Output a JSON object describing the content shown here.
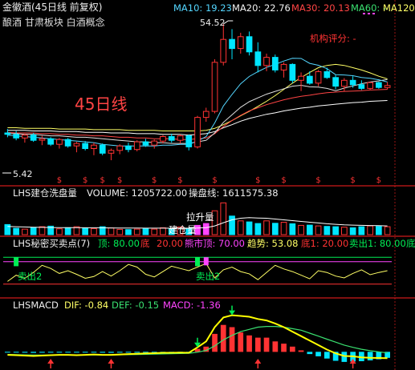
{
  "colors": {
    "bg": "#000000",
    "up": "#ff3333",
    "down": "#00e5ff",
    "ma10": "#54d6ff",
    "ma20": "#f2f2f2",
    "ma30": "#ff4444",
    "ma60": "#3ae070",
    "ma120": "#ffff66",
    "grid": "#ff2020",
    "magenta": "#ff44ff",
    "white": "#ffffff",
    "yellow": "#ffff00",
    "green": "#00ee55",
    "label": "#dddddd"
  },
  "price_panel": {
    "title": "金徽酒(45日线 前复权)",
    "concepts": "酿酒 甘肃板块 白酒概念",
    "ma10_label": "MA10: 19.23",
    "ma20_label": "MA20: 22.76",
    "ma30_label": "MA30: 20.13",
    "ma60_label": "MA60: -",
    "ma120_label": "MA120",
    "rating_label": "机构评分: -",
    "period_annotation": "45日线",
    "high_marker": "54.52",
    "low_marker": "5.42",
    "signal_glyph": "$"
  },
  "volume_panel": {
    "name": "LHS建仓洗盘量",
    "volume_label": "VOLUME: 1205722.00",
    "control_label": "操盘线: 1611575.38",
    "tag_top": "拉升量",
    "tag_bottom": "建仓量"
  },
  "signal_panel": {
    "name": "LHS秘密买卖点(7)",
    "top_label": "顶: 80.00",
    "bottom_label": "底",
    "bottom_value": "20.00",
    "bull_top_label": "熊市顶: 70.00",
    "trend_label": "趋势: 53.08",
    "bottom1_label": "底1: 20.00",
    "sell1_label": "卖出1: 80.00",
    "tail_label": "底",
    "sell2_tag": "卖出2"
  },
  "macd_panel": {
    "name": "LHSMACD",
    "dif_label": "DIF: -0.84",
    "def_label": "DEF: -0.15",
    "macd_label": "MACD: -1.36"
  },
  "chart_data": [
    {
      "type": "candlestick",
      "title": "金徽酒(45日线 前复权)",
      "ohlc": [
        [
          8.6,
          9.2,
          8.0,
          8.4
        ],
        [
          8.4,
          8.9,
          7.6,
          7.9
        ],
        [
          7.9,
          8.5,
          7.3,
          8.3
        ],
        [
          8.3,
          8.6,
          7.4,
          7.6
        ],
        [
          7.6,
          8.2,
          7.0,
          7.8
        ],
        [
          7.8,
          8.0,
          6.9,
          7.1
        ],
        [
          7.1,
          7.9,
          6.6,
          7.7
        ],
        [
          7.7,
          7.9,
          6.7,
          6.9
        ],
        [
          6.9,
          7.4,
          6.2,
          7.2
        ],
        [
          7.2,
          7.5,
          6.4,
          6.6
        ],
        [
          6.6,
          7.3,
          5.9,
          7.0
        ],
        [
          7.0,
          7.2,
          5.9,
          6.1
        ],
        [
          6.1,
          6.6,
          5.42,
          6.4
        ],
        [
          6.4,
          7.1,
          6.0,
          6.9
        ],
        [
          6.9,
          7.3,
          6.2,
          6.5
        ],
        [
          6.5,
          7.6,
          6.3,
          7.4
        ],
        [
          7.4,
          7.8,
          6.8,
          7.0
        ],
        [
          7.0,
          7.7,
          6.6,
          7.5
        ],
        [
          7.5,
          8.3,
          7.2,
          8.1
        ],
        [
          8.1,
          8.5,
          7.3,
          7.6
        ],
        [
          7.6,
          8.4,
          7.2,
          8.2
        ],
        [
          8.2,
          8.4,
          6.4,
          6.8
        ],
        [
          6.8,
          11.5,
          6.6,
          11.2
        ],
        [
          11.2,
          13.2,
          10.4,
          12.4
        ],
        [
          12.4,
          30.0,
          12.0,
          28.5
        ],
        [
          28.5,
          54.52,
          27.0,
          42.0
        ],
        [
          42.0,
          50.0,
          30.0,
          36.0
        ],
        [
          36.0,
          47.0,
          33.0,
          44.0
        ],
        [
          44.0,
          48.0,
          32.0,
          34.0
        ],
        [
          34.0,
          40.0,
          24.0,
          27.0
        ],
        [
          27.0,
          33.0,
          24.5,
          31.0
        ],
        [
          31.0,
          32.5,
          24.0,
          25.0
        ],
        [
          25.0,
          28.5,
          22.0,
          27.5
        ],
        [
          27.5,
          28.0,
          20.0,
          21.0
        ],
        [
          21.0,
          24.0,
          17.5,
          22.5
        ],
        [
          22.5,
          24.5,
          19.5,
          20.0
        ],
        [
          20.0,
          25.0,
          19.0,
          24.3
        ],
        [
          24.3,
          26.0,
          21.5,
          22.0
        ],
        [
          22.0,
          23.0,
          18.0,
          19.0
        ],
        [
          19.0,
          21.8,
          17.5,
          21.0
        ],
        [
          21.0,
          22.5,
          18.5,
          19.5
        ],
        [
          19.5,
          21.0,
          17.8,
          18.3
        ],
        [
          18.3,
          20.5,
          17.8,
          20.2
        ],
        [
          20.2,
          20.5,
          18.2,
          18.6
        ],
        [
          18.6,
          20.4,
          18.0,
          19.23
        ]
      ],
      "ma10": [
        8.3,
        8.2,
        8.1,
        8.0,
        7.9,
        7.8,
        7.7,
        7.6,
        7.5,
        7.4,
        7.3,
        7.1,
        7.0,
        6.9,
        6.9,
        6.9,
        6.9,
        6.9,
        7.0,
        7.0,
        7.1,
        7.1,
        7.5,
        8.1,
        10.2,
        13.6,
        16.5,
        19.8,
        22.4,
        24.3,
        26.1,
        27.5,
        29.1,
        30.5,
        30.4,
        28.0,
        27.1,
        25.6,
        23.1,
        23.0,
        22.7,
        22.0,
        21.7,
        21.2,
        20.4
      ],
      "ma20": [
        8.5,
        8.5,
        8.4,
        8.4,
        8.3,
        8.2,
        8.2,
        8.1,
        8.0,
        8.0,
        7.9,
        7.8,
        7.7,
        7.6,
        7.5,
        7.4,
        7.4,
        7.3,
        7.3,
        7.2,
        7.2,
        7.2,
        7.4,
        7.6,
        8.6,
        10.3,
        11.7,
        13.3,
        14.6,
        15.6,
        16.6,
        17.4,
        18.2,
        19.0,
        19.3,
        18.8,
        18.7,
        18.3,
        17.6,
        18.4,
        19.1,
        19.8,
        20.4,
        20.8,
        21.3
      ],
      "ma30": [
        8.7,
        8.6,
        8.6,
        8.6,
        8.5,
        8.5,
        8.4,
        8.4,
        8.3,
        8.3,
        8.2,
        8.2,
        8.1,
        8.0,
        8.0,
        7.9,
        7.9,
        7.8,
        7.8,
        7.8,
        7.7,
        7.7,
        7.8,
        7.9,
        8.5,
        9.6,
        10.6,
        11.6,
        12.5,
        13.2,
        13.9,
        14.5,
        15.1,
        15.6,
        16.0,
        16.3,
        16.7,
        17.0,
        17.2,
        17.4,
        17.5,
        17.6,
        17.8,
        17.9,
        18.0
      ],
      "ma60": [
        9.0,
        9.0,
        9.0,
        8.9,
        8.9,
        8.9,
        8.8,
        8.8,
        8.8,
        8.7,
        8.7,
        8.7,
        8.6,
        8.6,
        8.6,
        8.5,
        8.5,
        8.5,
        8.4,
        8.4,
        8.4,
        8.3,
        8.4,
        8.5,
        8.8,
        9.4,
        9.9,
        10.5,
        11.0,
        11.4,
        11.8,
        12.1,
        12.5,
        12.8,
        13.1,
        13.3,
        13.6,
        13.8,
        14.0,
        14.2,
        14.4,
        14.5,
        14.7,
        14.8,
        14.9
      ],
      "ma120": [
        9.4,
        9.4,
        9.3,
        9.3,
        9.3,
        9.3,
        9.2,
        9.2,
        9.2,
        9.2,
        9.1,
        9.1,
        9.1,
        9.1,
        9.0,
        9.0,
        9.0,
        9.0,
        8.9,
        8.9,
        8.9,
        8.9,
        8.9,
        9.0,
        9.3,
        9.9,
        10.6,
        11.5,
        12.4,
        13.5,
        14.7,
        16.2,
        18.0,
        20.0,
        22.0,
        24.0,
        26.0,
        27.0,
        27.5,
        27.0,
        26.0,
        25.0,
        23.8,
        22.5,
        21.5
      ],
      "signal_days": [
        6,
        9,
        11,
        13,
        17,
        20,
        24,
        29,
        32,
        36,
        40,
        43
      ]
    },
    {
      "type": "bar",
      "title": "LHS建仓洗盘量",
      "volume": [
        380000,
        240000,
        210000,
        260000,
        300000,
        320000,
        220000,
        260000,
        300000,
        240000,
        230000,
        300000,
        250000,
        200000,
        190000,
        210000,
        230000,
        210000,
        260000,
        220000,
        290000,
        240000,
        350000,
        420000,
        900000,
        1200000,
        700000,
        520000,
        480000,
        420000,
        520000,
        430000,
        470000,
        410000,
        350000,
        360000,
        330000,
        310000,
        300000,
        280000,
        260000,
        300000,
        330000,
        310000,
        300000
      ],
      "control_line": [
        310000,
        300000,
        290000,
        280000,
        275000,
        270000,
        265000,
        262000,
        262000,
        260000,
        260000,
        258000,
        255000,
        252000,
        250000,
        248000,
        246000,
        244000,
        244000,
        243000,
        244000,
        245000,
        252000,
        265000,
        330000,
        450000,
        560000,
        620000,
        640000,
        630000,
        620000,
        590000,
        560000,
        530000,
        500000,
        470000,
        440000,
        410000,
        390000,
        370000,
        360000,
        350000,
        345000,
        340000,
        330000
      ],
      "ylim": [
        0,
        1300000
      ]
    },
    {
      "type": "line",
      "title": "LHS秘密买卖点(7)",
      "trend": [
        26,
        40,
        33,
        46,
        62,
        55,
        44,
        50,
        42,
        33,
        37,
        48,
        38,
        50,
        64,
        58,
        42,
        36,
        48,
        60,
        55,
        50,
        58,
        66,
        34,
        52,
        58,
        48,
        43,
        30,
        46,
        62,
        54,
        48,
        40,
        32,
        50,
        46,
        38,
        34,
        44,
        52,
        41,
        46,
        50
      ],
      "ylim": [
        0,
        100
      ],
      "levels": {
        "top": 80,
        "bear_top": 70,
        "bottom": 20
      },
      "sell2_days": [
        1,
        22
      ]
    },
    {
      "type": "bar",
      "title": "LHSMACD",
      "macd": [
        -0.08,
        -0.1,
        -0.12,
        -0.14,
        -0.12,
        -0.1,
        -0.08,
        -0.09,
        -0.11,
        -0.1,
        -0.09,
        -0.12,
        -0.13,
        -0.11,
        -0.08,
        -0.06,
        -0.05,
        -0.04,
        -0.02,
        -0.03,
        -0.02,
        -0.05,
        0.4,
        0.7,
        2.4,
        3.6,
        3.3,
        2.6,
        2.2,
        1.9,
        1.9,
        1.4,
        1.1,
        0.7,
        0.2,
        -0.3,
        -0.6,
        -0.9,
        -1.2,
        -1.35,
        -1.3,
        -1.25,
        -1.15,
        -1.0,
        -0.8
      ],
      "dif": [
        -0.4,
        -0.45,
        -0.5,
        -0.55,
        -0.5,
        -0.45,
        -0.4,
        -0.4,
        -0.45,
        -0.4,
        -0.35,
        -0.4,
        -0.4,
        -0.35,
        -0.3,
        -0.25,
        -0.2,
        -0.18,
        -0.12,
        -0.12,
        -0.1,
        -0.12,
        0.6,
        1.4,
        3.3,
        4.6,
        4.9,
        4.8,
        4.7,
        4.4,
        4.2,
        3.8,
        3.3,
        2.7,
        2.1,
        1.5,
        0.9,
        0.3,
        -0.2,
        -0.55,
        -0.6,
        -0.75,
        -0.8,
        -0.82,
        -0.84
      ],
      "dea": [
        -0.35,
        -0.37,
        -0.4,
        -0.42,
        -0.43,
        -0.43,
        -0.42,
        -0.42,
        -0.42,
        -0.41,
        -0.4,
        -0.4,
        -0.4,
        -0.39,
        -0.37,
        -0.35,
        -0.33,
        -0.3,
        -0.27,
        -0.25,
        -0.22,
        -0.2,
        -0.05,
        0.2,
        0.8,
        1.6,
        2.2,
        2.7,
        3.0,
        3.3,
        3.4,
        3.4,
        3.3,
        3.1,
        2.9,
        2.5,
        2.1,
        1.7,
        1.3,
        0.9,
        0.6,
        0.35,
        0.15,
        0.0,
        -0.15
      ],
      "ylim": [
        -2,
        5.5
      ],
      "buy_arrows": [
        5,
        12,
        29,
        40
      ],
      "sell_arrows": [
        22,
        26
      ]
    }
  ]
}
